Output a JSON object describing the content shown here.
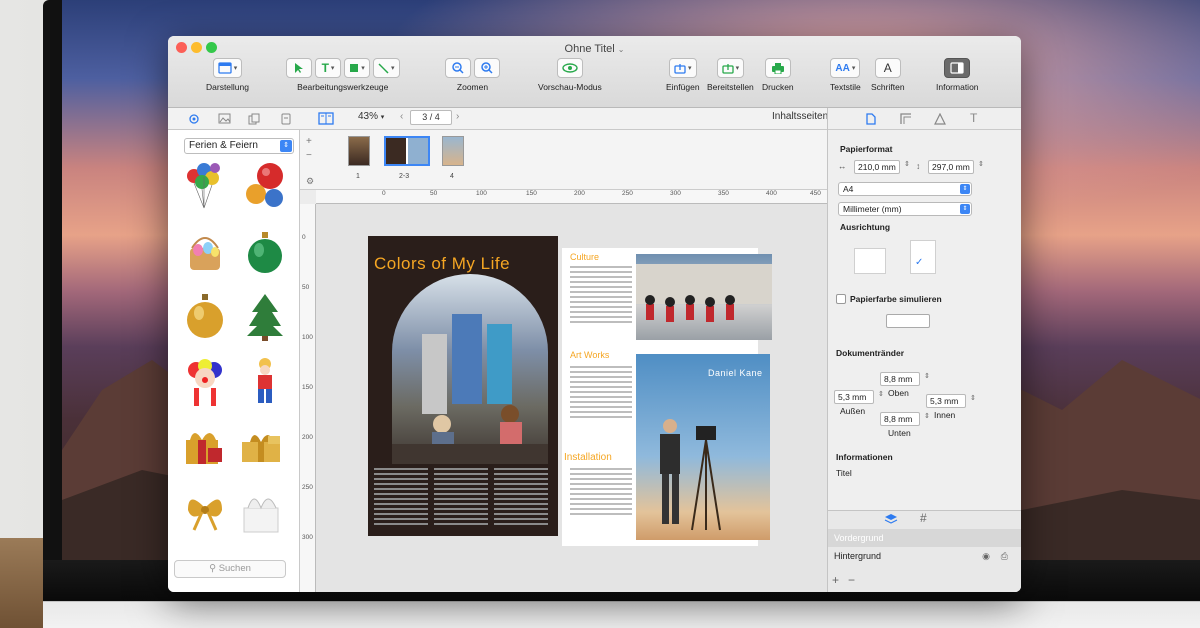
{
  "window": {
    "title": "Ohne Titel",
    "title_chevron": "⌄"
  },
  "toolbar": {
    "darstellung": "Darstellung",
    "bearbeitungswerkzeuge": "Bearbeitungswerkzeuge",
    "zoomen": "Zoomen",
    "vorschau_modus": "Vorschau-Modus",
    "einfuegen": "Einfügen",
    "bereitstellen": "Bereitstellen",
    "drucken": "Drucken",
    "textstile": "Textstile",
    "schriften": "Schriften",
    "information": "Information"
  },
  "subbar": {
    "zoom": "43%",
    "page_indicator": "3 / 4",
    "pages_mode": "Inhaltsseiten"
  },
  "sidebar": {
    "category": "Ferien & Feiern",
    "search_placeholder": "Suchen",
    "cliparts": [
      "balloons-icon",
      "christmas-balls-red-icon",
      "easter-basket-icon",
      "green-ornament-icon",
      "gold-ornament-icon",
      "christmas-tree-icon",
      "clown-icon",
      "clown-boy-icon",
      "red-gift-icon",
      "gold-gift-icon",
      "bow-icon",
      "ribbon-box-icon"
    ]
  },
  "thumbnails": [
    {
      "label": "1"
    },
    {
      "label": "2-3"
    },
    {
      "label": "4"
    }
  ],
  "ruler": {
    "h_ticks": [
      "0",
      "50",
      "100",
      "150",
      "200",
      "250",
      "300",
      "350",
      "400",
      "450"
    ],
    "v_ticks": [
      "0",
      "50",
      "100",
      "150",
      "200",
      "250",
      "300"
    ]
  },
  "spread": {
    "title": "Colors of My Life",
    "sections": [
      "Culture",
      "Art Works",
      "Installation"
    ],
    "photographer_name": "Daniel Kane"
  },
  "inspector": {
    "papierformat": "Papierformat",
    "width": "210,0 mm",
    "height": "297,0 mm",
    "paper_size": "A4",
    "unit": "Millimeter (mm)",
    "ausrichtung": "Ausrichtung",
    "papierfarbe": "Papierfarbe simulieren",
    "dokumentraender": "Dokumentränder",
    "top_margin": "8,8 mm",
    "top_label": "Oben",
    "outer_margin": "5,3 mm",
    "outer_label": "Außen",
    "inner_margin": "5,3 mm",
    "inner_label": "Innen",
    "bottom_margin": "8,8 mm",
    "bottom_label": "Unten",
    "informationen": "Informationen",
    "titel_label": "Titel"
  },
  "layers": {
    "vordergrund": "Vordergrund",
    "hintergrund": "Hintergrund"
  },
  "colors": {
    "accent": "#3c86f5",
    "title_orange": "#f5a623",
    "traffic_red": "#fc5f57",
    "traffic_yellow": "#fdbc2e",
    "traffic_green": "#34c84a"
  }
}
